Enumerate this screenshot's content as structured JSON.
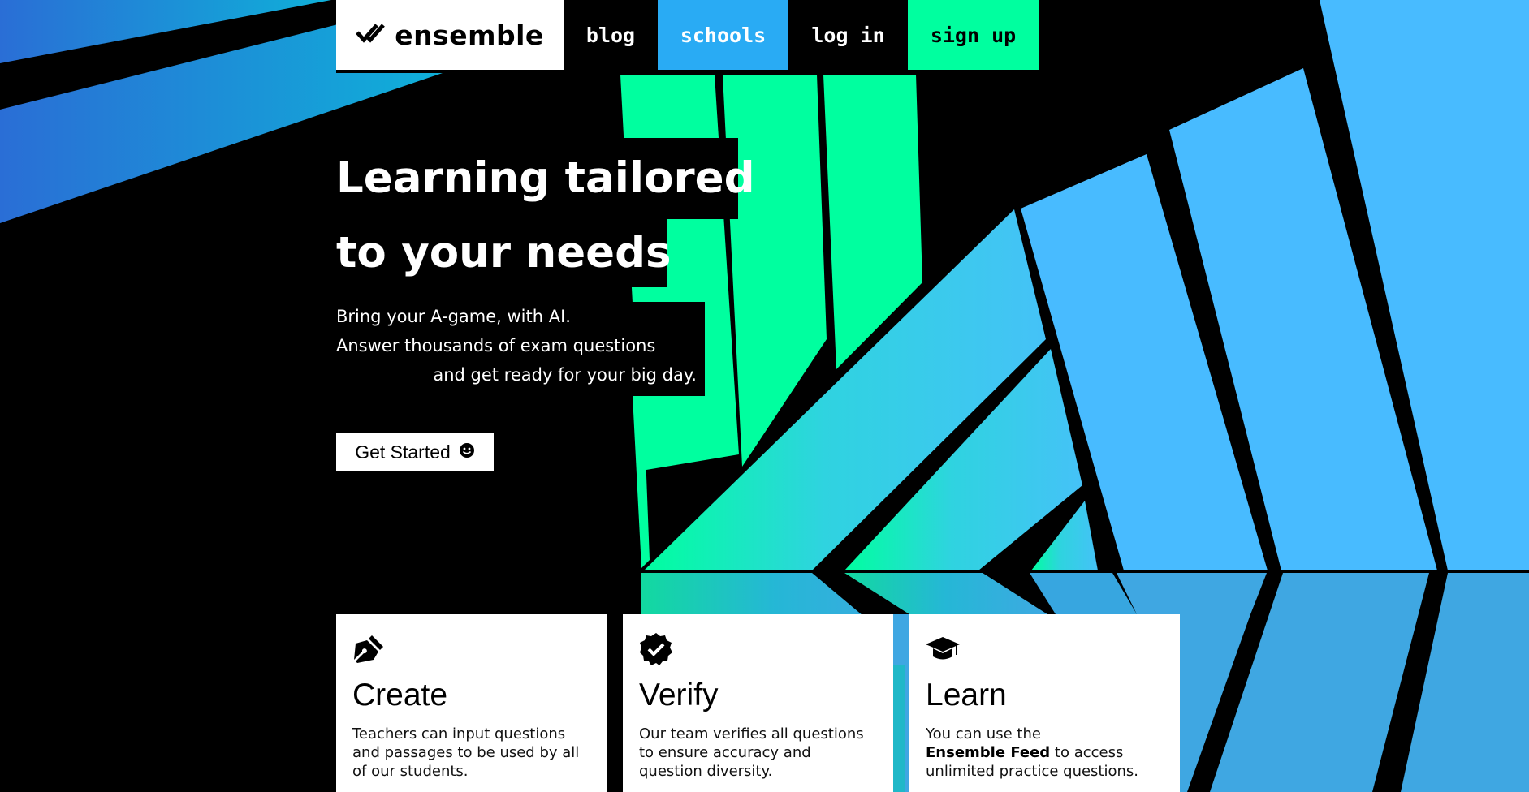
{
  "brand": {
    "name": "ensemble"
  },
  "nav": {
    "blog": "blog",
    "schools": "schools",
    "login": "log in",
    "signup": "sign up"
  },
  "hero": {
    "title_line1": "Learning tailored",
    "title_line2": "to your needs",
    "sub_line1": "Bring your A-game, with AI.",
    "sub_line2": "Answer thousands of exam questions",
    "sub_line3": "and get ready for your big day.",
    "cta": "Get Started"
  },
  "cards": [
    {
      "title": "Create",
      "text": "Teachers can input questions and passages to be used by all of our students.",
      "icon": "pen-nib-icon"
    },
    {
      "title": "Verify",
      "text": "Our team verifies all questions to ensure accuracy and question diversity.",
      "icon": "verified-badge-icon"
    },
    {
      "title": "Learn",
      "text_before": "You can use the",
      "text_bold": "Ensemble Feed",
      "text_after": "to access unlimited practice questions.",
      "icon": "graduation-cap-icon"
    }
  ],
  "colors": {
    "green": "#00ff9f",
    "sky_blue": "#48bbff",
    "schools_blue": "#29abf4",
    "deep_blue": "#2a6ed6",
    "background": "#000000"
  }
}
